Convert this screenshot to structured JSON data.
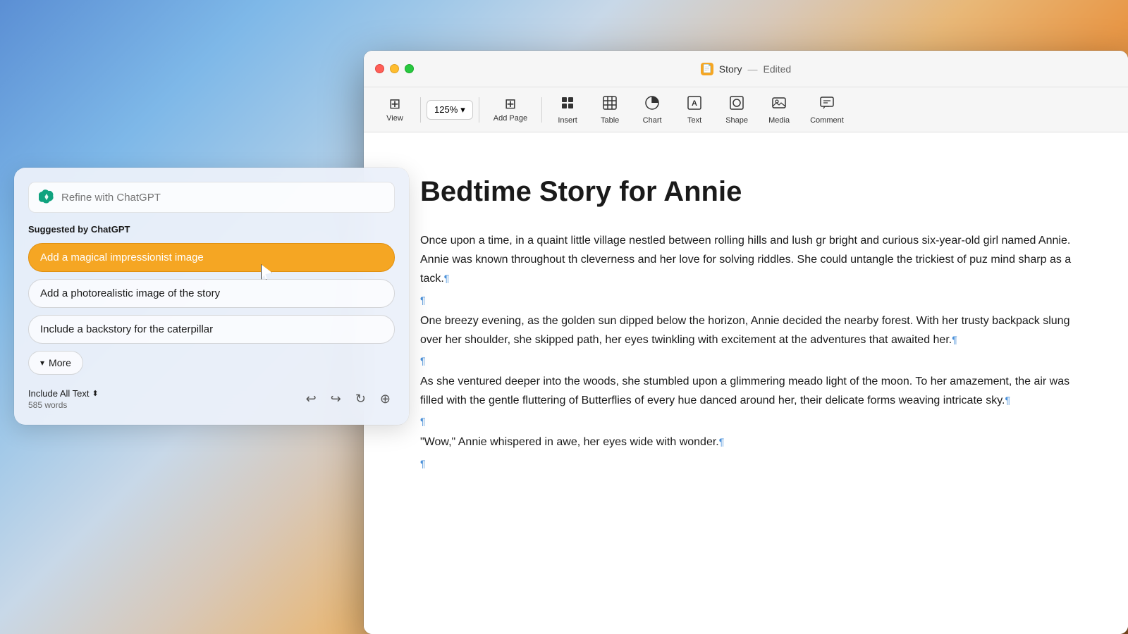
{
  "desktop": {
    "background": "macOS Sonoma gradient"
  },
  "window": {
    "title": "Story",
    "separator": "—",
    "edited_label": "Edited",
    "title_icon": "📄"
  },
  "toolbar": {
    "view_label": "View",
    "zoom_value": "125%",
    "zoom_chevron": "▾",
    "add_page_label": "Add Page",
    "insert_label": "Insert",
    "table_label": "Table",
    "chart_label": "Chart",
    "text_label": "Text",
    "shape_label": "Shape",
    "media_label": "Media",
    "comment_label": "Comment"
  },
  "document": {
    "title": "Bedtime Story for Annie",
    "paragraph1": "Once upon a time, in a quaint little village nestled between rolling hills and lush gr bright and curious six-year-old girl named Annie. Annie was known throughout th cleverness and her love for solving riddles. She could untangle the trickiest of puz mind sharp as a tack.",
    "paragraph2": "One breezy evening, as the golden sun dipped below the horizon, Annie decided the nearby forest. With her trusty backpack slung over her shoulder, she skipped path, her eyes twinkling with excitement at the adventures that awaited her.",
    "paragraph3": "As she ventured deeper into the woods, she stumbled upon a glimmering meado light of the moon. To her amazement, the air was filled with the gentle fluttering of Butterflies of every hue danced around her, their delicate forms weaving intricate sky.",
    "paragraph4": "\"Wow,\" Annie whispered in awe, her eyes wide with wonder."
  },
  "chatgpt_panel": {
    "search_placeholder": "Refine with ChatGPT",
    "suggested_label": "Suggested by ChatGPT",
    "suggestions": [
      {
        "id": "s1",
        "label": "Add a magical impressionist image",
        "style": "highlighted"
      },
      {
        "id": "s2",
        "label": "Add a photorealistic image of the story",
        "style": "outlined"
      },
      {
        "id": "s3",
        "label": "Include a backstory for the caterpillar",
        "style": "outlined"
      }
    ],
    "more_label": "More",
    "include_all_text_label": "Include All Text",
    "word_count": "585 words",
    "undo_icon": "↩",
    "redo_icon": "↪",
    "refresh_icon": "↻",
    "add_icon": "⊕"
  }
}
